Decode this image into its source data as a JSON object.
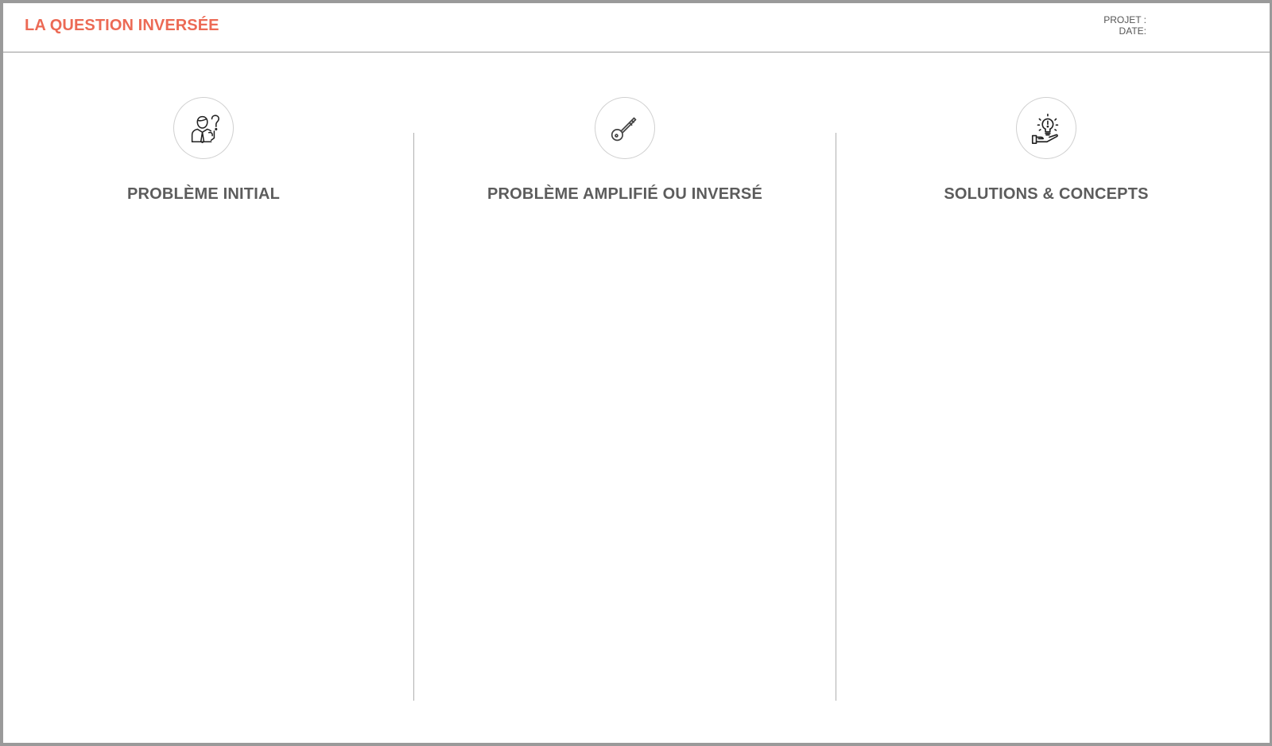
{
  "header": {
    "title": "LA QUESTION INVERSÉE",
    "project_label": "PROJET :",
    "date_label": "DATE:"
  },
  "colors": {
    "accent": "#ec6a55",
    "heading": "#5c5c5c",
    "border": "#9a9a9a"
  },
  "columns": [
    {
      "title": "PROBLÈME INITIAL",
      "icon": "person-question-icon"
    },
    {
      "title": "PROBLÈME AMPLIFIÉ OU INVERSÉ",
      "icon": "key-icon"
    },
    {
      "title": "SOLUTIONS & CONCEPTS",
      "icon": "lightbulb-hand-icon"
    }
  ]
}
